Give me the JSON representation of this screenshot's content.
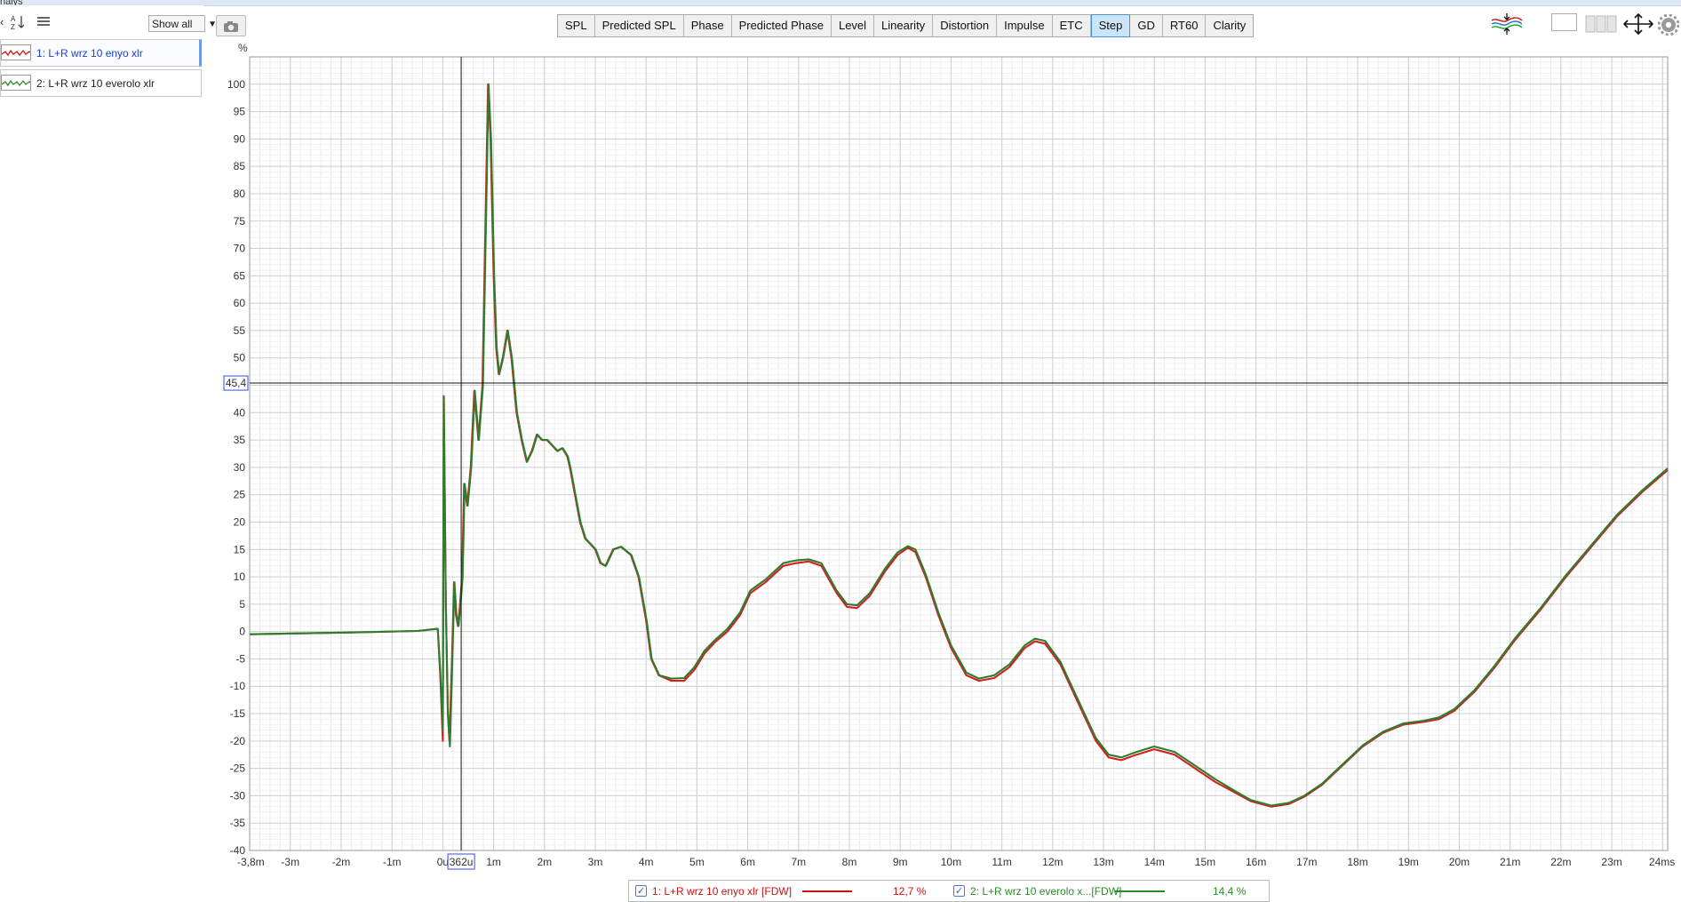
{
  "window": {
    "title_fragment": "nalys"
  },
  "sidebar": {
    "show_all_label": "Show all",
    "measurements": [
      {
        "label": "1: L+R wrz 10 enyo xlr",
        "color": "#cc1111",
        "selected": true,
        "label_color": "#1a3fd9"
      },
      {
        "label": "2: L+R wrz 10 everolo xlr",
        "color": "#2a8a2a",
        "selected": false,
        "label_color": "#111111"
      }
    ]
  },
  "toolbar": {
    "tabs": [
      "SPL",
      "Predicted SPL",
      "Phase",
      "Predicted Phase",
      "Level",
      "Linearity",
      "Distortion",
      "Impulse",
      "ETC",
      "Step",
      "GD",
      "RT60",
      "Clarity"
    ],
    "active_tab": "Step"
  },
  "cursor": {
    "x_readout": "362u",
    "y_readout": "45,4",
    "x_ms": 0.362,
    "y_value": 45.4
  },
  "legend": [
    {
      "label": "1: L+R wrz 10 enyo xlr [FDW]",
      "value": "12,7 %",
      "color": "#cc1111"
    },
    {
      "label": "2: L+R wrz 10 everolo x...[FDW]",
      "value": "14,4 %",
      "color": "#2a8a2a"
    }
  ],
  "chart_data": {
    "type": "line",
    "ylabel": "%",
    "xlim": [
      -3.8,
      24.1
    ],
    "ylim": [
      -40,
      105
    ],
    "x_unit": "ms",
    "x_ticks": [
      -3.8,
      -3,
      -2,
      -1,
      0,
      1,
      2,
      3,
      4,
      5,
      6,
      7,
      8,
      9,
      10,
      11,
      12,
      13,
      14,
      15,
      16,
      17,
      18,
      19,
      20,
      21,
      22,
      23,
      24
    ],
    "x_tick_labels": [
      "-3,8m",
      "-3m",
      "-2m",
      "-1m",
      "0u",
      "1m",
      "2m",
      "3m",
      "4m",
      "5m",
      "6m",
      "7m",
      "8m",
      "9m",
      "10m",
      "11m",
      "12m",
      "13m",
      "14m",
      "15m",
      "16m",
      "17m",
      "18m",
      "19m",
      "20m",
      "21m",
      "22m",
      "23m",
      "24ms"
    ],
    "y_ticks": [
      -40,
      -35,
      -30,
      -25,
      -20,
      -15,
      -10,
      -5,
      0,
      5,
      10,
      15,
      20,
      25,
      30,
      35,
      40,
      45,
      50,
      55,
      60,
      65,
      70,
      75,
      80,
      85,
      90,
      95,
      100
    ],
    "grid": true,
    "legend_position": "bottom",
    "series": [
      {
        "name": "1: L+R wrz 10 enyo xlr [FDW]",
        "color": "#d42020",
        "points": [
          [
            -3.8,
            -0.5
          ],
          [
            -2,
            -0.2
          ],
          [
            -0.5,
            0.1
          ],
          [
            -0.1,
            0.5
          ],
          [
            -0.05,
            -8
          ],
          [
            0.0,
            -20
          ],
          [
            0.02,
            43
          ],
          [
            0.06,
            5
          ],
          [
            0.1,
            -15
          ],
          [
            0.13,
            -20
          ],
          [
            0.18,
            -5
          ],
          [
            0.22,
            9
          ],
          [
            0.26,
            3
          ],
          [
            0.3,
            1
          ],
          [
            0.34,
            5
          ],
          [
            0.38,
            10
          ],
          [
            0.42,
            27
          ],
          [
            0.48,
            23
          ],
          [
            0.55,
            30
          ],
          [
            0.62,
            44
          ],
          [
            0.7,
            35
          ],
          [
            0.78,
            45
          ],
          [
            0.85,
            80
          ],
          [
            0.89,
            100
          ],
          [
            0.94,
            90
          ],
          [
            1.0,
            65
          ],
          [
            1.05,
            52
          ],
          [
            1.1,
            47
          ],
          [
            1.18,
            50
          ],
          [
            1.27,
            55
          ],
          [
            1.35,
            50
          ],
          [
            1.45,
            40
          ],
          [
            1.55,
            35
          ],
          [
            1.65,
            31
          ],
          [
            1.75,
            33
          ],
          [
            1.85,
            36
          ],
          [
            1.95,
            35
          ],
          [
            2.05,
            35
          ],
          [
            2.15,
            34
          ],
          [
            2.25,
            33
          ],
          [
            2.35,
            33.5
          ],
          [
            2.45,
            32
          ],
          [
            2.5,
            30
          ],
          [
            2.6,
            25
          ],
          [
            2.7,
            20
          ],
          [
            2.8,
            17
          ],
          [
            2.9,
            16
          ],
          [
            3.0,
            15
          ],
          [
            3.1,
            12.5
          ],
          [
            3.2,
            12
          ],
          [
            3.35,
            15
          ],
          [
            3.5,
            15.5
          ],
          [
            3.7,
            14
          ],
          [
            3.85,
            10
          ],
          [
            4.0,
            2
          ],
          [
            4.1,
            -5
          ],
          [
            4.25,
            -8
          ],
          [
            4.5,
            -9
          ],
          [
            4.75,
            -9
          ],
          [
            4.95,
            -7
          ],
          [
            5.15,
            -4
          ],
          [
            5.35,
            -2
          ],
          [
            5.6,
            0
          ],
          [
            5.85,
            3
          ],
          [
            6.05,
            7
          ],
          [
            6.35,
            9
          ],
          [
            6.7,
            12
          ],
          [
            6.95,
            12.5
          ],
          [
            7.2,
            12.8
          ],
          [
            7.45,
            12
          ],
          [
            7.75,
            7
          ],
          [
            7.95,
            4.5
          ],
          [
            8.15,
            4.3
          ],
          [
            8.4,
            6.5
          ],
          [
            8.7,
            11
          ],
          [
            8.95,
            14
          ],
          [
            9.15,
            15.3
          ],
          [
            9.3,
            14.5
          ],
          [
            9.5,
            10
          ],
          [
            9.75,
            3
          ],
          [
            10.0,
            -3
          ],
          [
            10.3,
            -8
          ],
          [
            10.55,
            -9
          ],
          [
            10.85,
            -8.5
          ],
          [
            11.15,
            -6.5
          ],
          [
            11.45,
            -3
          ],
          [
            11.65,
            -1.8
          ],
          [
            11.85,
            -2.2
          ],
          [
            12.15,
            -6
          ],
          [
            12.5,
            -13
          ],
          [
            12.85,
            -20
          ],
          [
            13.1,
            -23
          ],
          [
            13.35,
            -23.5
          ],
          [
            13.65,
            -22.5
          ],
          [
            14.0,
            -21.5
          ],
          [
            14.4,
            -22.5
          ],
          [
            14.8,
            -25
          ],
          [
            15.2,
            -27.5
          ],
          [
            15.6,
            -29.5
          ],
          [
            15.9,
            -31
          ],
          [
            16.3,
            -32
          ],
          [
            16.65,
            -31.5
          ],
          [
            16.95,
            -30.2
          ],
          [
            17.3,
            -28
          ],
          [
            17.7,
            -24.5
          ],
          [
            18.1,
            -21
          ],
          [
            18.5,
            -18.5
          ],
          [
            18.9,
            -17
          ],
          [
            19.3,
            -16.5
          ],
          [
            19.6,
            -16
          ],
          [
            19.9,
            -14.5
          ],
          [
            20.3,
            -11
          ],
          [
            20.7,
            -6.5
          ],
          [
            21.1,
            -1.5
          ],
          [
            21.6,
            4
          ],
          [
            22.1,
            10
          ],
          [
            22.6,
            15.5
          ],
          [
            23.1,
            21
          ],
          [
            23.6,
            25.5
          ],
          [
            24.1,
            29.5
          ]
        ]
      },
      {
        "name": "2: L+R wrz 10 everolo x...[FDW]",
        "color": "#2e7d2e",
        "points": [
          [
            -3.8,
            -0.5
          ],
          [
            -2,
            -0.2
          ],
          [
            -0.5,
            0.1
          ],
          [
            -0.1,
            0.5
          ],
          [
            -0.05,
            -7
          ],
          [
            0.0,
            -18
          ],
          [
            0.02,
            43
          ],
          [
            0.06,
            5
          ],
          [
            0.1,
            -15
          ],
          [
            0.14,
            -21
          ],
          [
            0.19,
            -5
          ],
          [
            0.23,
            9
          ],
          [
            0.27,
            3
          ],
          [
            0.31,
            1
          ],
          [
            0.35,
            5
          ],
          [
            0.39,
            10
          ],
          [
            0.43,
            27
          ],
          [
            0.49,
            23
          ],
          [
            0.56,
            30
          ],
          [
            0.63,
            44
          ],
          [
            0.71,
            35
          ],
          [
            0.79,
            45
          ],
          [
            0.86,
            80
          ],
          [
            0.9,
            100
          ],
          [
            0.95,
            90
          ],
          [
            1.01,
            65
          ],
          [
            1.06,
            52
          ],
          [
            1.11,
            47
          ],
          [
            1.19,
            50
          ],
          [
            1.28,
            55
          ],
          [
            1.36,
            50
          ],
          [
            1.46,
            40
          ],
          [
            1.56,
            35
          ],
          [
            1.66,
            31
          ],
          [
            1.76,
            33
          ],
          [
            1.86,
            36
          ],
          [
            1.96,
            35
          ],
          [
            2.06,
            35
          ],
          [
            2.16,
            34
          ],
          [
            2.26,
            33
          ],
          [
            2.36,
            33.5
          ],
          [
            2.46,
            32
          ],
          [
            2.51,
            30
          ],
          [
            2.61,
            25
          ],
          [
            2.71,
            20
          ],
          [
            2.81,
            17
          ],
          [
            2.91,
            16
          ],
          [
            3.01,
            15
          ],
          [
            3.11,
            12.5
          ],
          [
            3.21,
            12
          ],
          [
            3.36,
            15
          ],
          [
            3.51,
            15.5
          ],
          [
            3.71,
            14
          ],
          [
            3.86,
            10
          ],
          [
            4.01,
            2
          ],
          [
            4.11,
            -5
          ],
          [
            4.26,
            -8
          ],
          [
            4.5,
            -8.6
          ],
          [
            4.75,
            -8.5
          ],
          [
            4.95,
            -6.5
          ],
          [
            5.15,
            -3.5
          ],
          [
            5.35,
            -1.6
          ],
          [
            5.6,
            0.5
          ],
          [
            5.85,
            3.5
          ],
          [
            6.05,
            7.5
          ],
          [
            6.35,
            9.5
          ],
          [
            6.7,
            12.5
          ],
          [
            6.95,
            13
          ],
          [
            7.2,
            13.2
          ],
          [
            7.45,
            12.5
          ],
          [
            7.75,
            7.5
          ],
          [
            7.95,
            5
          ],
          [
            8.15,
            4.8
          ],
          [
            8.4,
            7
          ],
          [
            8.7,
            11.5
          ],
          [
            8.95,
            14.5
          ],
          [
            9.15,
            15.6
          ],
          [
            9.3,
            15
          ],
          [
            9.5,
            10.5
          ],
          [
            9.75,
            3.5
          ],
          [
            10.0,
            -2.5
          ],
          [
            10.3,
            -7.5
          ],
          [
            10.55,
            -8.6
          ],
          [
            10.85,
            -8
          ],
          [
            11.15,
            -6
          ],
          [
            11.45,
            -2.5
          ],
          [
            11.65,
            -1.3
          ],
          [
            11.85,
            -1.7
          ],
          [
            12.15,
            -5.5
          ],
          [
            12.5,
            -12.5
          ],
          [
            12.85,
            -19.5
          ],
          [
            13.1,
            -22.5
          ],
          [
            13.35,
            -23
          ],
          [
            13.65,
            -22
          ],
          [
            14.0,
            -21
          ],
          [
            14.4,
            -22
          ],
          [
            14.8,
            -24.5
          ],
          [
            15.2,
            -27
          ],
          [
            15.6,
            -29.2
          ],
          [
            15.9,
            -30.8
          ],
          [
            16.3,
            -31.8
          ],
          [
            16.65,
            -31.3
          ],
          [
            16.95,
            -30
          ],
          [
            17.3,
            -27.8
          ],
          [
            17.7,
            -24.3
          ],
          [
            18.1,
            -20.8
          ],
          [
            18.5,
            -18.3
          ],
          [
            18.9,
            -16.8
          ],
          [
            19.3,
            -16.3
          ],
          [
            19.6,
            -15.7
          ],
          [
            19.9,
            -14.2
          ],
          [
            20.3,
            -10.7
          ],
          [
            20.7,
            -6.2
          ],
          [
            21.1,
            -1.2
          ],
          [
            21.6,
            4.3
          ],
          [
            22.1,
            10.3
          ],
          [
            22.6,
            15.8
          ],
          [
            23.1,
            21.3
          ],
          [
            23.6,
            25.8
          ],
          [
            24.1,
            29.8
          ]
        ]
      }
    ]
  }
}
